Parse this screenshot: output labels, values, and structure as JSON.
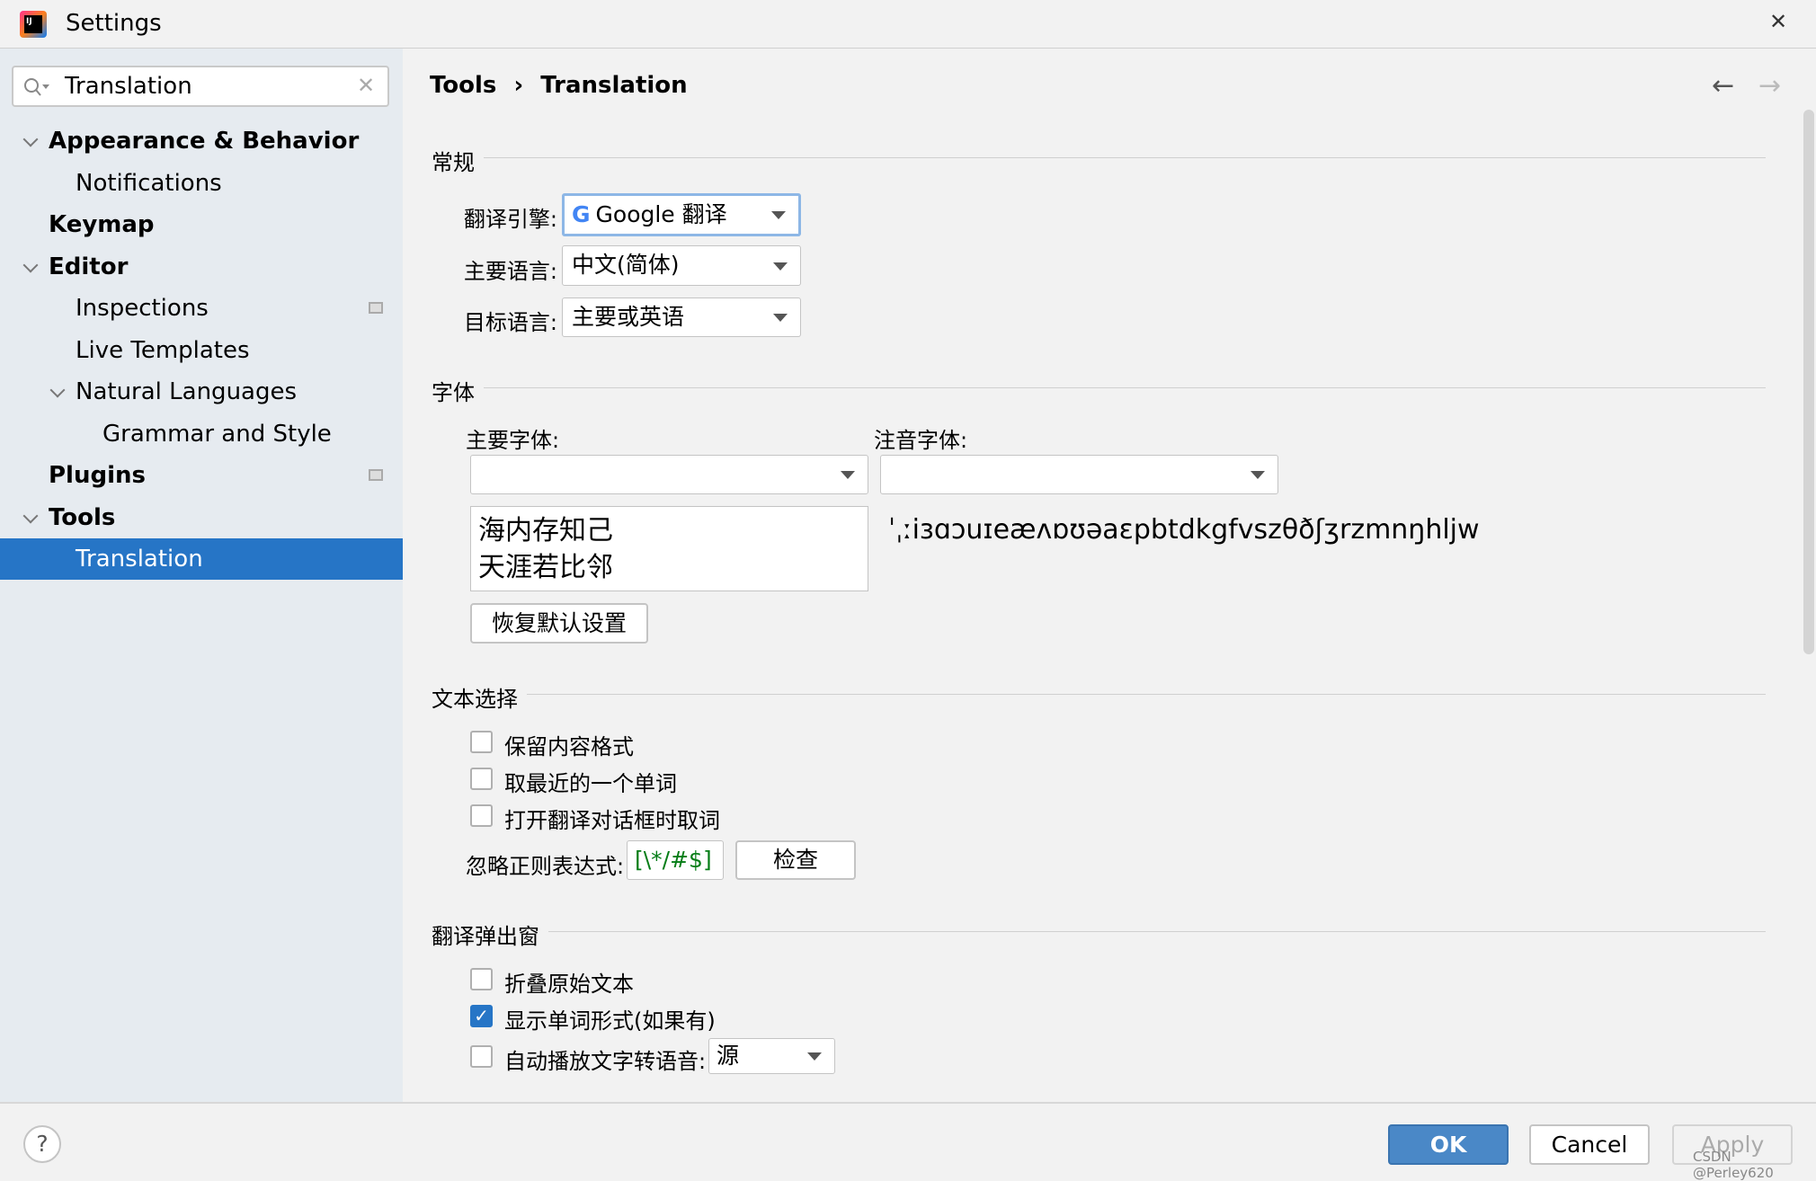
{
  "window": {
    "title": "Settings",
    "close": "✕"
  },
  "search": {
    "value": "Translation"
  },
  "sidebar": {
    "items": [
      {
        "label": "Appearance & Behavior",
        "level": 0,
        "expanded": true,
        "bold": true
      },
      {
        "label": "Notifications",
        "level": 1
      },
      {
        "label": "Keymap",
        "level": 0,
        "bold": true
      },
      {
        "label": "Editor",
        "level": 0,
        "expanded": true,
        "bold": true
      },
      {
        "label": "Inspections",
        "level": 1,
        "badge": true
      },
      {
        "label": "Live Templates",
        "level": 1
      },
      {
        "label": "Natural Languages",
        "level": 1,
        "expanded": true
      },
      {
        "label": "Grammar and Style",
        "level": 2
      },
      {
        "label": "Plugins",
        "level": 0,
        "bold": true,
        "badge": true
      },
      {
        "label": "Tools",
        "level": 0,
        "expanded": true,
        "bold": true
      },
      {
        "label": "Translation",
        "level": 1,
        "selected": true
      }
    ]
  },
  "breadcrumb": {
    "parent": "Tools",
    "sep": "›",
    "current": "Translation"
  },
  "general": {
    "title": "常规",
    "engine_label": "翻译引擎:",
    "engine": "Google 翻译",
    "primary_lang_label": "主要语言:",
    "primary_lang": "中文(简体)",
    "target_lang_label": "目标语言:",
    "target_lang": "主要或英语"
  },
  "font": {
    "title": "字体",
    "primary_label": "主要字体:",
    "phonetic_label": "注音字体:",
    "preview_line1": "海内存知己",
    "preview_line2": "天涯若比邻",
    "phonetic_preview": "ˈˌːiɜɑɔuɪeæʌɒʊəaɛpbtdkgfvszθðʃʒrzmnŋhljw",
    "reset_button": "恢复默认设置"
  },
  "selection": {
    "title": "文本选择",
    "options": [
      {
        "label": "保留内容格式",
        "checked": false
      },
      {
        "label": "取最近的一个单词",
        "checked": false
      },
      {
        "label": "打开翻译对话框时取词",
        "checked": false
      }
    ],
    "regex_label": "忽略正则表达式:",
    "regex_value": "[\\*/#$]",
    "check_button": "检查"
  },
  "popup": {
    "title": "翻译弹出窗",
    "options": [
      {
        "label": "折叠原始文本",
        "checked": false
      },
      {
        "label": "显示单词形式(如果有)",
        "checked": true
      },
      {
        "label": "自动播放文字转语音:",
        "checked": false
      }
    ],
    "tts_value": "源"
  },
  "footer": {
    "help": "?",
    "ok": "OK",
    "cancel": "Cancel",
    "apply": "Apply",
    "watermark": "CSDN @Perley620"
  },
  "colors": {
    "accent": "#2675c6",
    "sidebar_bg": "#e6ebf0",
    "ok_bg": "#4a88c7"
  }
}
